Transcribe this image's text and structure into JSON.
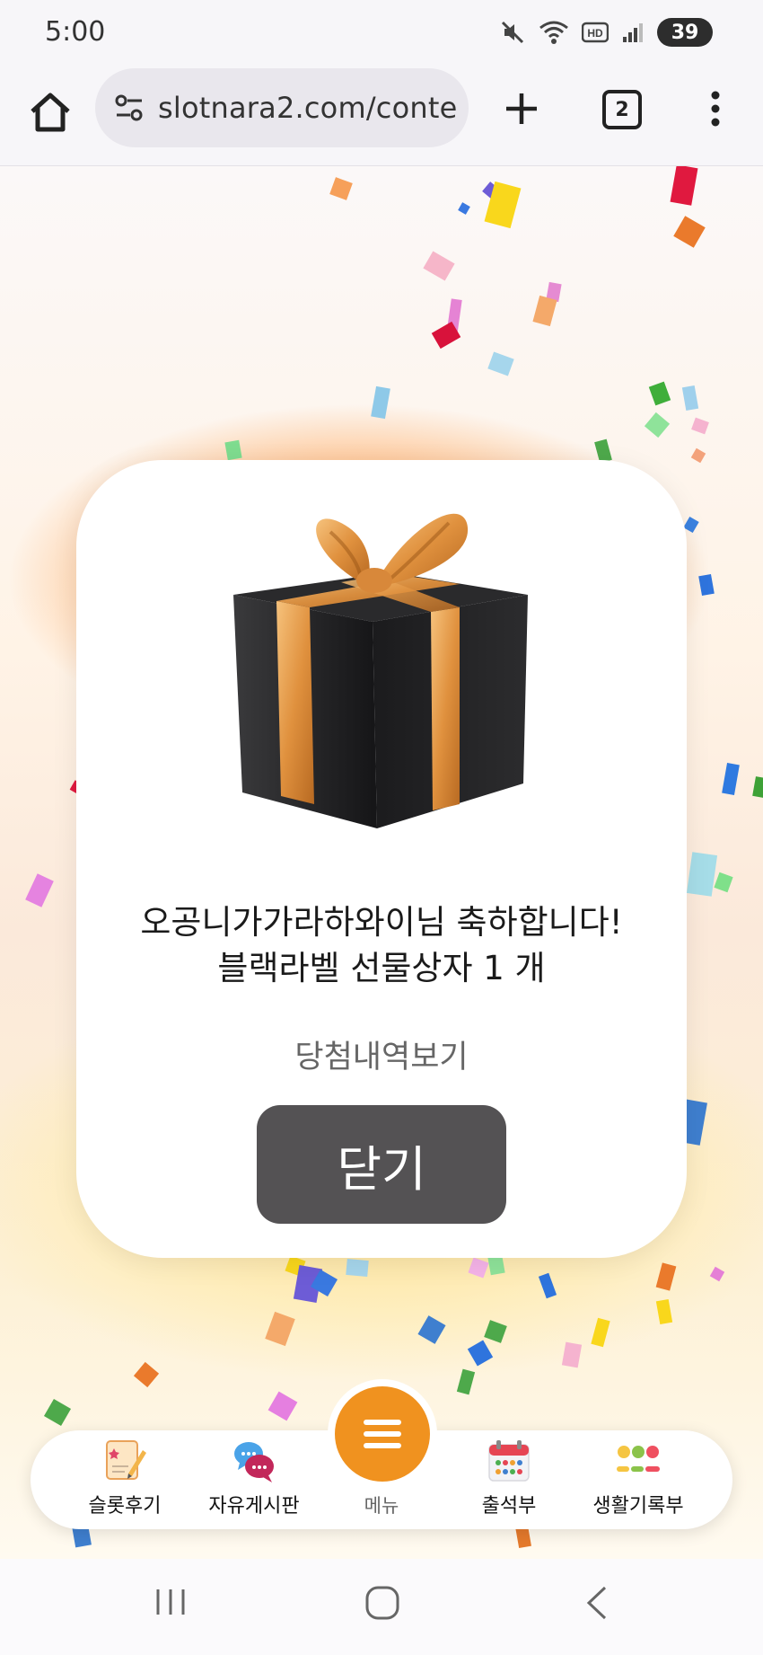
{
  "status_bar": {
    "time": "5:00",
    "battery": "39",
    "icons": [
      "mute-icon",
      "wifi-icon",
      "hd-icon",
      "signal-icon",
      "battery-charging-icon"
    ]
  },
  "browser": {
    "url": "slotnara2.com/conte",
    "tab_count": "2",
    "icons": [
      "home-icon",
      "site-settings-icon",
      "new-tab-plus-icon",
      "tabs-icon",
      "more-vert-icon"
    ]
  },
  "modal": {
    "line1": "오공니가가라하와이님 축하합니다!",
    "line2": "블랙라벨 선물상자 1 개",
    "history_link": "당첨내역보기",
    "close_label": "닫기"
  },
  "bottom_nav": {
    "items": [
      {
        "label": "슬롯후기",
        "icon": "review-note-icon"
      },
      {
        "label": "자유게시판",
        "icon": "chat-bubbles-icon"
      },
      {
        "label": "메뉴",
        "icon": "hamburger-menu-icon"
      },
      {
        "label": "출석부",
        "icon": "calendar-icon"
      },
      {
        "label": "생활기록부",
        "icon": "emoji-faces-icon"
      }
    ]
  },
  "colors": {
    "accent_orange": "#f0921f",
    "close_button": "#545254",
    "gift_box": "#1c1c1e",
    "ribbon_gold": "#e39a45"
  }
}
